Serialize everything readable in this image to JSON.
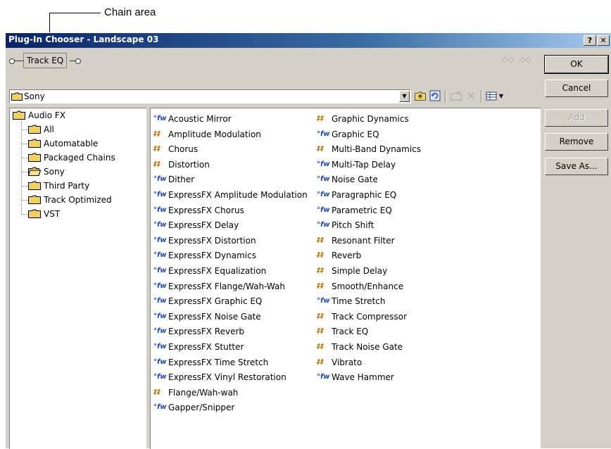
{
  "callout": {
    "label": "Chain area"
  },
  "window": {
    "title": "Plug-In Chooser - Landscape 03",
    "help_label": "?",
    "close_label": "✕"
  },
  "chain": {
    "item_label": "Track EQ"
  },
  "buttons": {
    "ok": "OK",
    "cancel": "Cancel",
    "add": "Add",
    "remove": "Remove",
    "save_as": "Save As..."
  },
  "path": {
    "value": "Sony"
  },
  "tree": {
    "root": "Audio FX",
    "children": [
      "All",
      "Automatable",
      "Packaged Chains",
      "Sony",
      "Third Party",
      "Track Optimized",
      "VST"
    ]
  },
  "plugins": {
    "column1": [
      {
        "label": "Acoustic Mirror",
        "icon": "dx-plugin-icon"
      },
      {
        "label": "Amplitude Modulation",
        "icon": "fx-plugin-icon"
      },
      {
        "label": "Chorus",
        "icon": "fx-plugin-icon"
      },
      {
        "label": "Distortion",
        "icon": "fx-plugin-icon"
      },
      {
        "label": "Dither",
        "icon": "dx-plugin-icon"
      },
      {
        "label": "ExpressFX Amplitude Modulation",
        "icon": "dx-plugin-icon"
      },
      {
        "label": "ExpressFX Chorus",
        "icon": "dx-plugin-icon"
      },
      {
        "label": "ExpressFX Delay",
        "icon": "dx-plugin-icon"
      },
      {
        "label": "ExpressFX Distortion",
        "icon": "dx-plugin-icon"
      },
      {
        "label": "ExpressFX Dynamics",
        "icon": "dx-plugin-icon"
      },
      {
        "label": "ExpressFX Equalization",
        "icon": "dx-plugin-icon"
      },
      {
        "label": "ExpressFX Flange/Wah-Wah",
        "icon": "dx-plugin-icon"
      },
      {
        "label": "ExpressFX Graphic EQ",
        "icon": "dx-plugin-icon"
      },
      {
        "label": "ExpressFX Noise Gate",
        "icon": "dx-plugin-icon"
      },
      {
        "label": "ExpressFX Reverb",
        "icon": "dx-plugin-icon"
      },
      {
        "label": "ExpressFX Stutter",
        "icon": "dx-plugin-icon"
      },
      {
        "label": "ExpressFX Time Stretch",
        "icon": "dx-plugin-icon"
      },
      {
        "label": "ExpressFX Vinyl Restoration",
        "icon": "dx-plugin-icon"
      },
      {
        "label": "Flange/Wah-wah",
        "icon": "fx-plugin-icon"
      },
      {
        "label": "Gapper/Snipper",
        "icon": "dx-plugin-icon"
      }
    ],
    "column2": [
      {
        "label": "Graphic Dynamics",
        "icon": "fx-plugin-icon"
      },
      {
        "label": "Graphic EQ",
        "icon": "dx-plugin-icon"
      },
      {
        "label": "Multi-Band Dynamics",
        "icon": "fx-plugin-icon"
      },
      {
        "label": "Multi-Tap Delay",
        "icon": "dx-plugin-icon"
      },
      {
        "label": "Noise Gate",
        "icon": "dx-plugin-icon"
      },
      {
        "label": "Paragraphic EQ",
        "icon": "dx-plugin-icon"
      },
      {
        "label": "Parametric EQ",
        "icon": "dx-plugin-icon"
      },
      {
        "label": "Pitch Shift",
        "icon": "dx-plugin-icon"
      },
      {
        "label": "Resonant Filter",
        "icon": "fx-plugin-icon"
      },
      {
        "label": "Reverb",
        "icon": "fx-plugin-icon"
      },
      {
        "label": "Simple Delay",
        "icon": "fx-plugin-icon"
      },
      {
        "label": "Smooth/Enhance",
        "icon": "fx-plugin-icon"
      },
      {
        "label": "Time Stretch",
        "icon": "dx-plugin-icon"
      },
      {
        "label": "Track Compressor",
        "icon": "fx-plugin-icon"
      },
      {
        "label": "Track EQ",
        "icon": "fx-plugin-icon"
      },
      {
        "label": "Track Noise Gate",
        "icon": "fx-plugin-icon"
      },
      {
        "label": "Vibrato",
        "icon": "fx-plugin-icon"
      },
      {
        "label": "Wave Hammer",
        "icon": "dx-plugin-icon"
      }
    ]
  },
  "colors": {
    "title_gradient_start": "#0a246a",
    "title_gradient_end": "#a6caf0",
    "dialog_face": "#d4d0c8",
    "folder_yellow": "#f2d25a"
  }
}
